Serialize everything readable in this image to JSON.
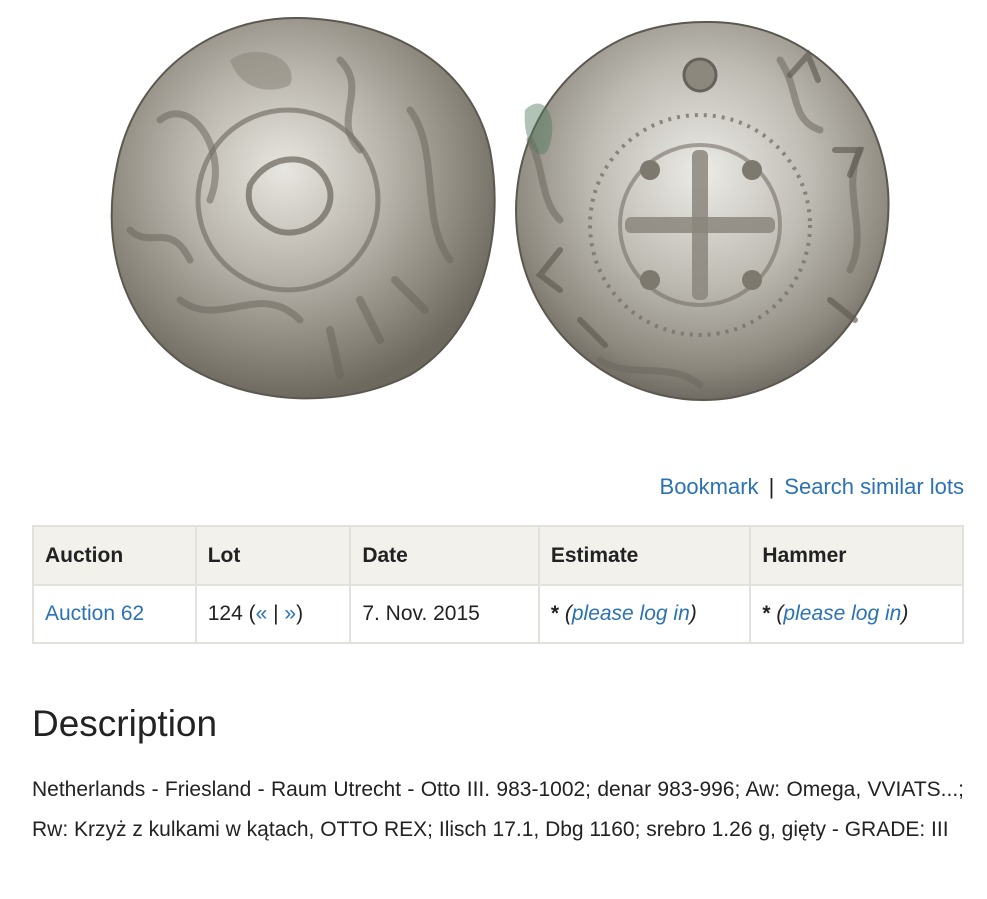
{
  "image": {
    "alt": ""
  },
  "actions": {
    "bookmark": "Bookmark",
    "separator": "|",
    "search_similar": "Search similar lots"
  },
  "table": {
    "headers": {
      "auction": "Auction",
      "lot": "Lot",
      "date": "Date",
      "estimate": "Estimate",
      "hammer": "Hammer"
    },
    "row": {
      "auction": "Auction 62",
      "lot_number": "124 (",
      "prev": "«",
      "lot_sep": " | ",
      "next": "»",
      "lot_close": ")",
      "date": "7. Nov. 2015",
      "estimate_star": "*",
      "estimate_open": " (",
      "estimate_link": "please log in",
      "estimate_close": ")",
      "hammer_star": "*",
      "hammer_open": " (",
      "hammer_link": "please log in",
      "hammer_close": ")"
    }
  },
  "description": {
    "title": "Description",
    "text": "Netherlands - Friesland - Raum Utrecht - Otto III. 983-1002; denar 983-996; Aw: Omega, VVIATS...; Rw: Krzyż z kulkami w kątach, OTTO REX; Ilisch 17.1, Dbg 1160; srebro 1.26 g, gięty - GRADE: III"
  },
  "colors": {
    "link": "#2a72b4",
    "header_bg": "#f2f1ec",
    "border": "#e3e1dc",
    "text": "#222222"
  }
}
